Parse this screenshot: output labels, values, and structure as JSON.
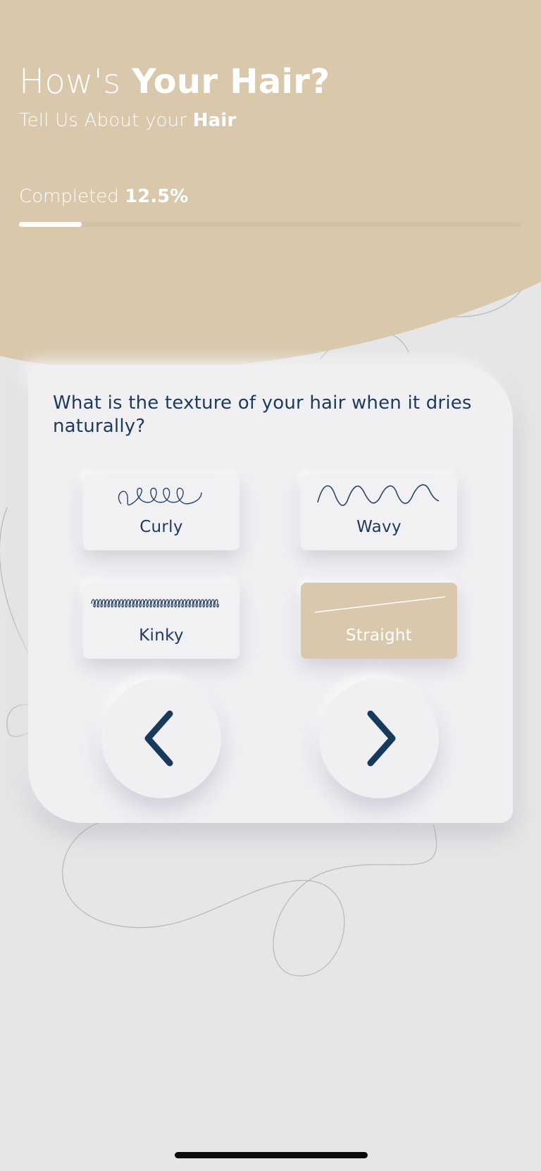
{
  "header": {
    "title_prefix": "How's ",
    "title_bold": "Your Hair?",
    "subtitle_prefix": "Tell Us About your ",
    "subtitle_bold": "Hair",
    "progress_prefix": "Completed ",
    "progress_value": "12.5%",
    "progress_fraction": 0.125
  },
  "question": "What is the texture of your hair when it dries naturally?",
  "options": [
    {
      "label": "Curly",
      "icon": "curly-hair-icon",
      "selected": false
    },
    {
      "label": "Wavy",
      "icon": "wavy-hair-icon",
      "selected": false
    },
    {
      "label": "Kinky",
      "icon": "kinky-hair-icon",
      "selected": false
    },
    {
      "label": "Straight",
      "icon": "straight-hair-icon",
      "selected": true
    }
  ],
  "navigation": {
    "back_icon": "chevron-left-icon",
    "next_icon": "chevron-right-icon"
  },
  "colors": {
    "header_beige": "#d9c8ab",
    "background": "#e6e6e7",
    "card": "#f0f0f3",
    "navy_text": "#1d3a5c",
    "white": "#ffffff"
  }
}
